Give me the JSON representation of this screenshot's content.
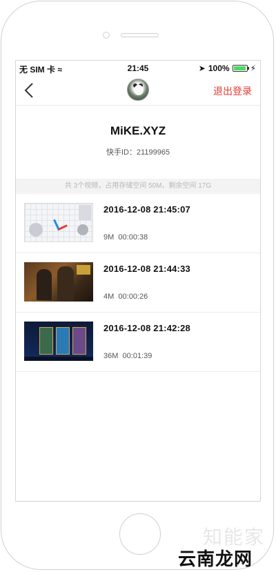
{
  "status_bar": {
    "carrier": "无 SIM 卡",
    "time": "21:45",
    "battery": "100%"
  },
  "nav": {
    "logout_label": "退出登录"
  },
  "profile": {
    "username": "MiKE.XYZ",
    "user_id": "快手ID：21199965"
  },
  "storage_summary": "共 3个视频，占用存储空间 50M，剩余空间 17G",
  "videos": [
    {
      "datetime": "2016-12-08  21:45:07",
      "size": "9M",
      "duration": "00:00:38"
    },
    {
      "datetime": "2016-12-08  21:44:33",
      "size": "4M",
      "duration": "00:00:26"
    },
    {
      "datetime": "2016-12-08  21:42:28",
      "size": "36M",
      "duration": "00:01:39"
    }
  ],
  "watermark": {
    "top": "知能家",
    "bottom": "云南龙网"
  },
  "colors": {
    "accent_red": "#e03c31",
    "battery_green": "#4cd964"
  }
}
